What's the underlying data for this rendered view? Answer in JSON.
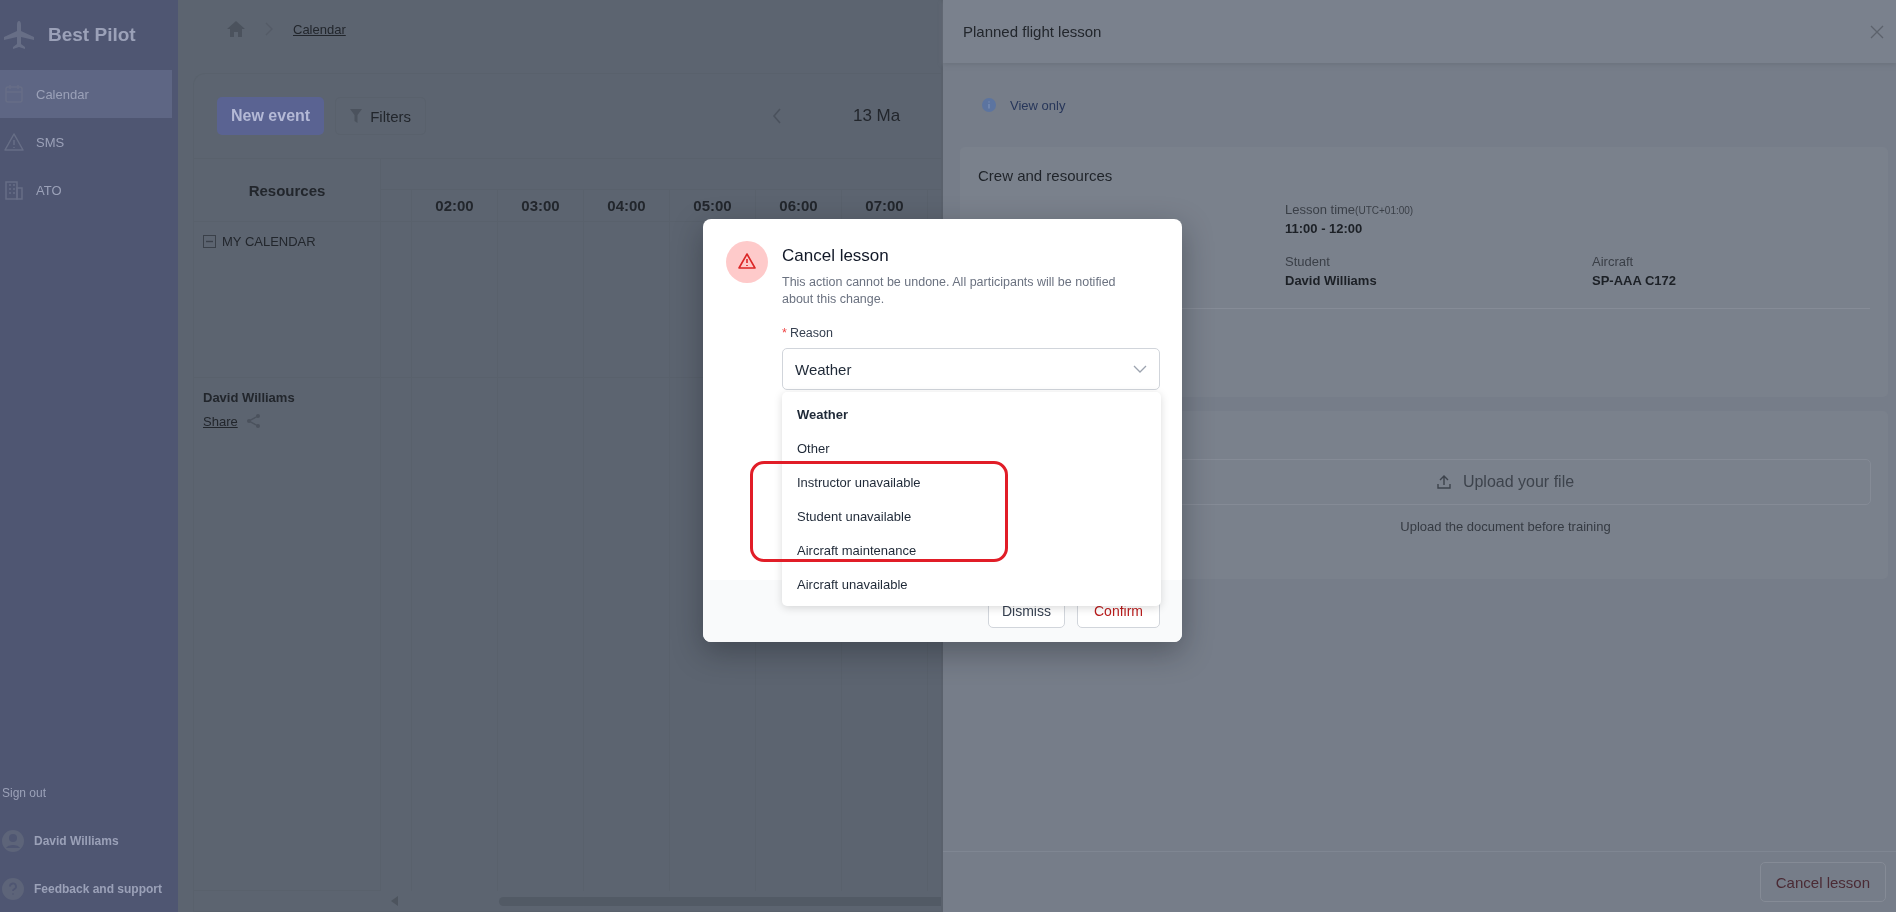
{
  "sidebar": {
    "logo": "Best Pilot",
    "items": [
      {
        "label": "Calendar",
        "kind": "calendar",
        "selected": true
      },
      {
        "label": "SMS",
        "kind": "warning",
        "selected": false
      },
      {
        "label": "ATO",
        "kind": "building",
        "selected": false
      }
    ],
    "sign_out": "Sign out",
    "user": "David Williams",
    "feedback": "Feedback and support"
  },
  "breadcrumb": [
    "Calendar"
  ],
  "toolbar": {
    "new_event": "New event",
    "filters": "Filters",
    "date": "13 Ma"
  },
  "calendar": {
    "resources_header": "Resources",
    "hours": [
      "02:00",
      "03:00",
      "04:00",
      "05:00",
      "06:00",
      "07:00"
    ],
    "groups": [
      {
        "label": "MY CALENDAR",
        "expanded": true
      }
    ],
    "rows": [
      {
        "name": "David Williams",
        "share": "Share"
      }
    ]
  },
  "drawer": {
    "title": "Planned flight lesson",
    "notice": "View only",
    "section_title": "Crew and resources",
    "fields": [
      {
        "label": "Lesson time",
        "note": "(UTC+01:00)",
        "value": "11:00 - 12:00"
      },
      {
        "label": "Student",
        "value": "David Williams"
      },
      {
        "label": "Aircraft",
        "value": "SP-AAA C172"
      }
    ],
    "upload_button": "Upload your file",
    "upload_hint": "Upload the document before training",
    "footer_button": "Cancel lesson"
  },
  "dialog": {
    "title": "Cancel lesson",
    "description": "This action cannot be undone. All participants will be notified about this change.",
    "field_label": "Reason",
    "required_mark": "*",
    "value": "Weather",
    "options": [
      {
        "label": "Weather",
        "selected": true
      },
      {
        "label": "Other",
        "selected": false
      },
      {
        "label": "Instructor unavailable",
        "selected": false
      },
      {
        "label": "Student unavailable",
        "selected": false
      },
      {
        "label": "Aircraft maintenance",
        "selected": false
      },
      {
        "label": "Aircraft unavailable",
        "selected": false
      }
    ],
    "buttons": [
      {
        "label": "Dismiss",
        "kind": "secondary"
      },
      {
        "label": "Confirm",
        "kind": "danger"
      }
    ]
  }
}
